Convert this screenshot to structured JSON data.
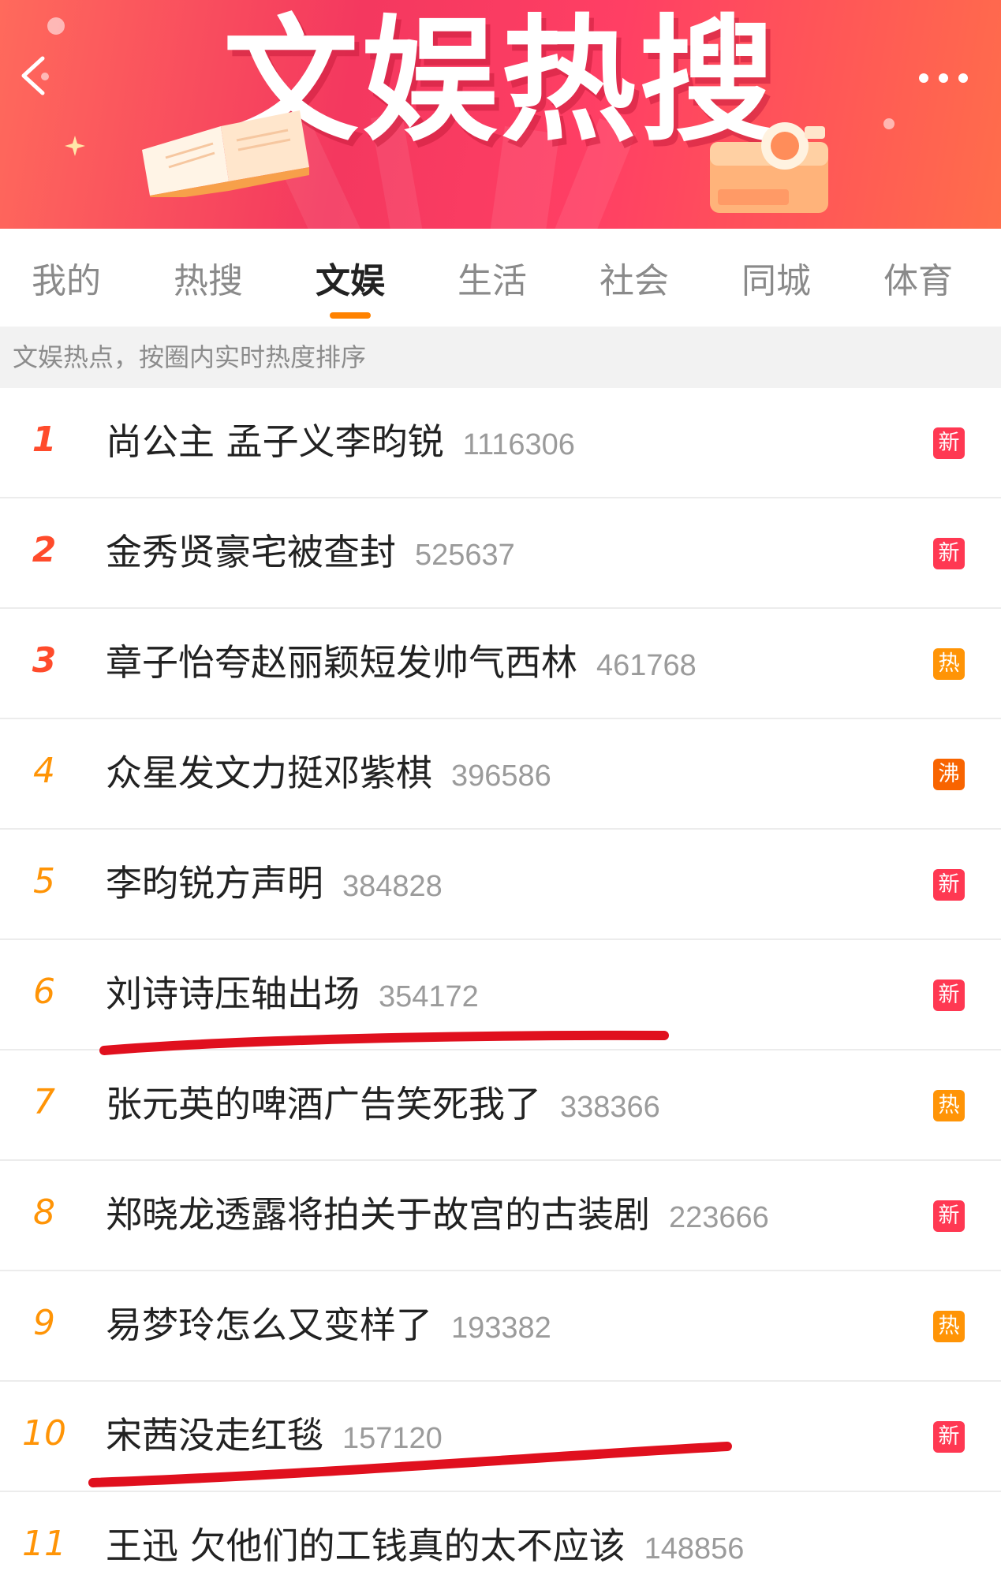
{
  "banner": {
    "title": "文娱热搜"
  },
  "colors": {
    "accent": "#ff8200",
    "new_badge": "#ff3852",
    "hot_badge": "#ff9406",
    "boil_badge": "#f86400",
    "rank_top": "#ff4b2b",
    "rank_other": "#ff9406",
    "annotation_red": "#e0101e"
  },
  "header": {
    "back_icon": "chevron-left-icon",
    "more_icon": "more-dots-icon"
  },
  "tabs": [
    {
      "label": "我的",
      "active": false
    },
    {
      "label": "热搜",
      "active": false
    },
    {
      "label": "文娱",
      "active": true
    },
    {
      "label": "生活",
      "active": false
    },
    {
      "label": "社会",
      "active": false
    },
    {
      "label": "同城",
      "active": false
    },
    {
      "label": "体育",
      "active": false
    }
  ],
  "subtitle": "文娱热点，按圈内实时热度排序",
  "items": [
    {
      "rank": "1",
      "title": "尚公主 孟子义李昀锐",
      "count": "1116306",
      "badge": "新",
      "badge_type": "new"
    },
    {
      "rank": "2",
      "title": "金秀贤豪宅被查封",
      "count": "525637",
      "badge": "新",
      "badge_type": "new"
    },
    {
      "rank": "3",
      "title": "章子怡夸赵丽颖短发帅气西林",
      "count": "461768",
      "badge": "热",
      "badge_type": "hot"
    },
    {
      "rank": "4",
      "title": "众星发文力挺邓紫棋",
      "count": "396586",
      "badge": "沸",
      "badge_type": "boil"
    },
    {
      "rank": "5",
      "title": "李昀锐方声明",
      "count": "384828",
      "badge": "新",
      "badge_type": "new"
    },
    {
      "rank": "6",
      "title": "刘诗诗压轴出场",
      "count": "354172",
      "badge": "新",
      "badge_type": "new"
    },
    {
      "rank": "7",
      "title": "张元英的啤酒广告笑死我了",
      "count": "338366",
      "badge": "热",
      "badge_type": "hot"
    },
    {
      "rank": "8",
      "title": "郑晓龙透露将拍关于故宫的古装剧",
      "count": "223666",
      "badge": "新",
      "badge_type": "new"
    },
    {
      "rank": "9",
      "title": "易梦玲怎么又变样了",
      "count": "193382",
      "badge": "热",
      "badge_type": "hot"
    },
    {
      "rank": "10",
      "title": "宋茜没走红毯",
      "count": "157120",
      "badge": "新",
      "badge_type": "new"
    },
    {
      "rank": "11",
      "title": "王迅 欠他们的工钱真的太不应该",
      "count": "148856",
      "badge": "",
      "badge_type": ""
    }
  ]
}
